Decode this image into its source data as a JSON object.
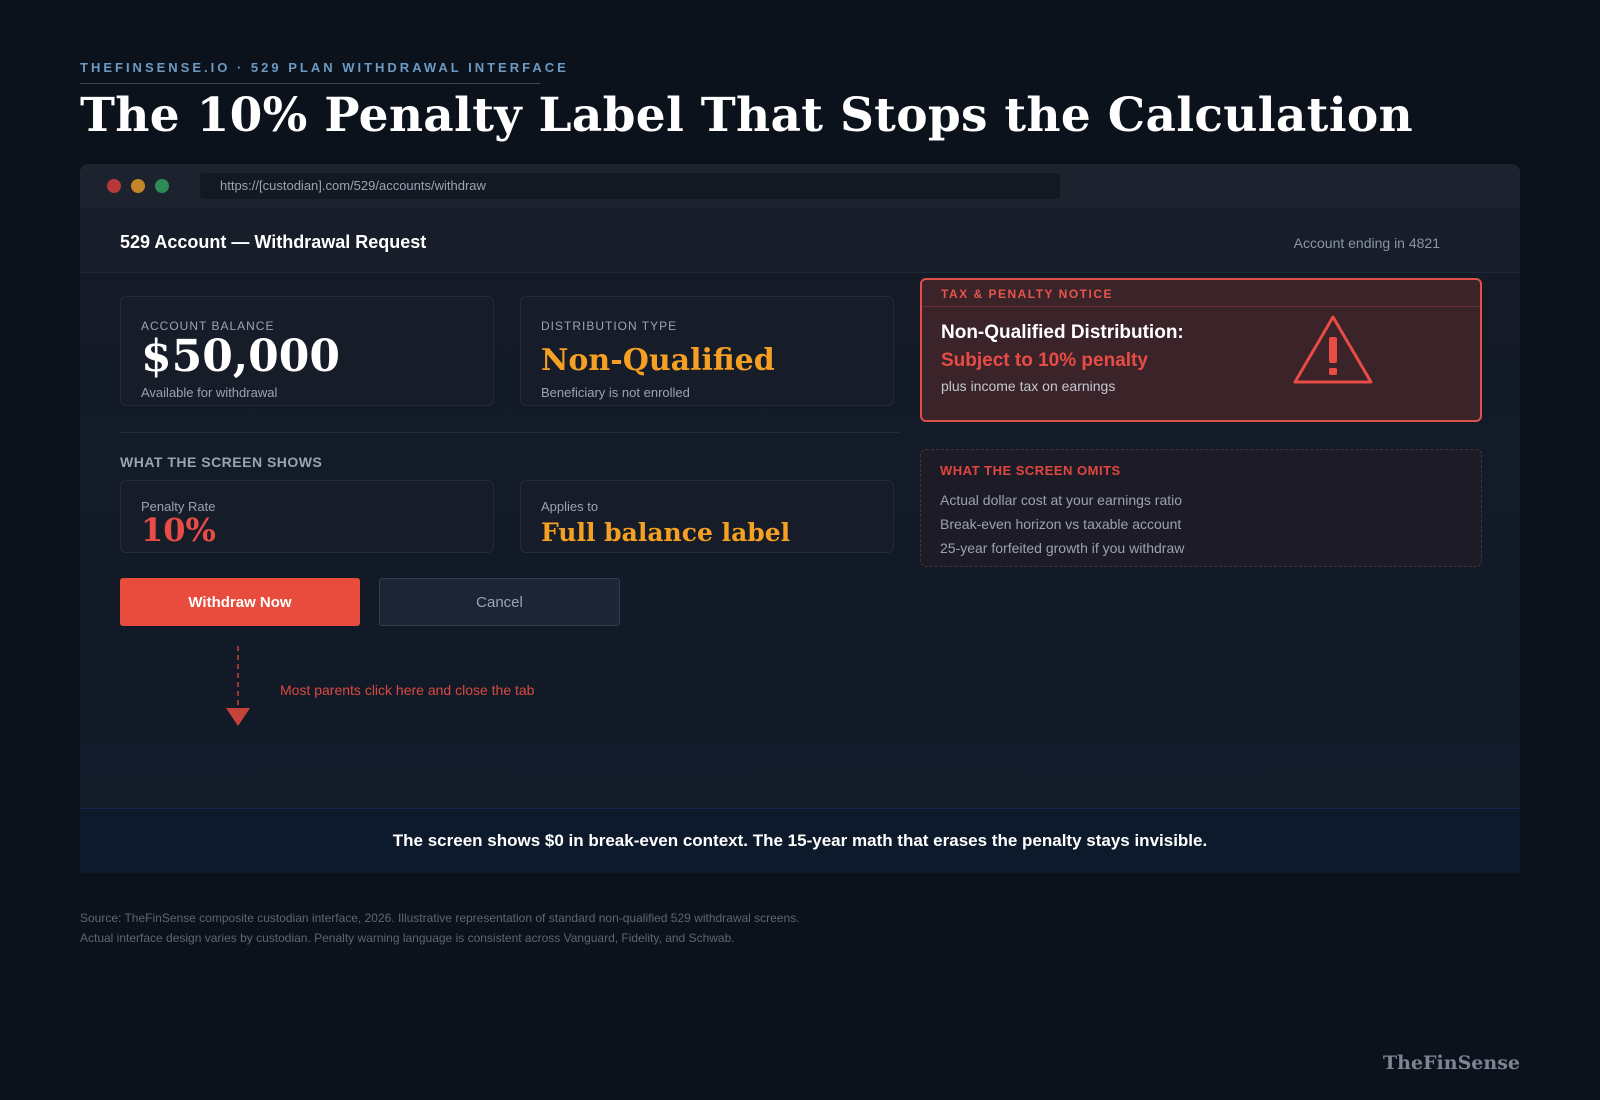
{
  "eyebrow": "THEFINSENSE.IO · 529 PLAN WITHDRAWAL INTERFACE",
  "headline": "The 10% Penalty Label That Stops the Calculation",
  "browser": {
    "url": "https://[custodian].com/529/accounts/withdraw"
  },
  "app": {
    "title": "529 Account — Withdrawal Request",
    "account_info": "Account ending in 4821"
  },
  "balance_card": {
    "label": "ACCOUNT BALANCE",
    "value": "$50,000",
    "sub": "Available for withdrawal"
  },
  "distribution_card": {
    "label": "DISTRIBUTION TYPE",
    "value": "Non-Qualified",
    "sub": "Beneficiary is not enrolled"
  },
  "notice": {
    "label": "TAX & PENALTY NOTICE",
    "title": "Non-Qualified Distribution:",
    "penalty": "Subject to 10% penalty",
    "sub": "plus income tax on earnings",
    "icon": "warning-triangle-icon"
  },
  "shows": {
    "title": "WHAT THE SCREEN SHOWS",
    "rate_label": "Penalty Rate",
    "rate_value": "10%",
    "applies_label": "Applies to",
    "applies_value": "Full balance label"
  },
  "omits": {
    "label": "WHAT THE SCREEN OMITS",
    "items": [
      "Actual dollar cost at your earnings ratio",
      "Break-even horizon vs taxable account",
      "25-year forfeited growth if you withdraw"
    ]
  },
  "buttons": {
    "primary": "Withdraw Now",
    "secondary": "Cancel"
  },
  "callout": "Most parents click here and close the tab",
  "banner": "The screen shows $0 in break-even context. The 15-year math that erases the penalty stays invisible.",
  "source": {
    "line1": "Source: TheFinSense composite custodian interface, 2026. Illustrative representation of standard non-qualified 529 withdrawal screens.",
    "line2": "Actual interface design varies by custodian. Penalty warning language is consistent across Vanguard, Fidelity, and Schwab."
  },
  "brand": "TheFinSense",
  "colors": {
    "background": "#0c121c",
    "accent_red": "#e84c3d",
    "accent_orange": "#f5a023",
    "eyebrow_blue": "#6b9bc4"
  }
}
